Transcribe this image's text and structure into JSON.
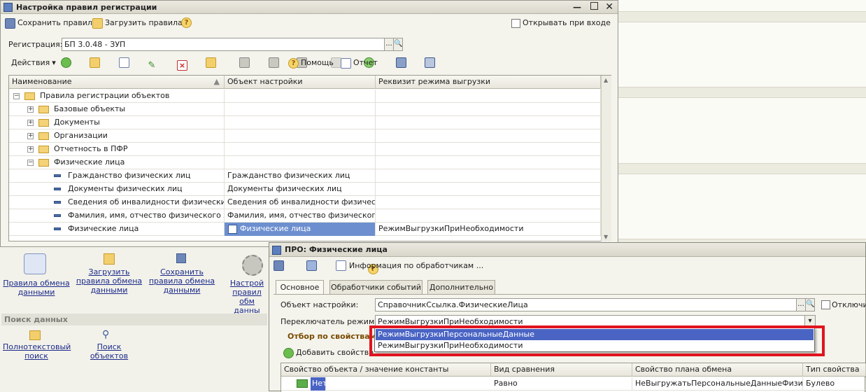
{
  "main_window": {
    "title": "Настройка правил регистрации",
    "toolbar": {
      "save_label": "Сохранить правила",
      "load_label": "Загрузить правила",
      "open_on_start_label": "Открывать при входе"
    },
    "registration_label": "Регистрация:",
    "registration_value": "БП 3.0.48 - ЗУП",
    "actions_label": "Действия",
    "help_label": "Помощь",
    "report_label": "Отчет",
    "columns": [
      "Наименование",
      "Объект настройки",
      "Реквизит режима выгрузки"
    ],
    "rows": [
      {
        "name": "Правила регистрации объектов",
        "object": "",
        "attr": ""
      },
      {
        "name": "Базовые объекты",
        "object": "",
        "attr": ""
      },
      {
        "name": "Документы",
        "object": "",
        "attr": ""
      },
      {
        "name": "Организации",
        "object": "",
        "attr": ""
      },
      {
        "name": "Отчетность в ПФР",
        "object": "",
        "attr": ""
      },
      {
        "name": "Физические лица",
        "object": "",
        "attr": ""
      },
      {
        "name": "Гражданство физических лиц",
        "object": "Гражданство физических лиц",
        "attr": ""
      },
      {
        "name": "Документы физических лиц",
        "object": "Документы физических лиц",
        "attr": ""
      },
      {
        "name": "Сведения об инвалидности физических л...",
        "object": "Сведения об инвалидности физическ...",
        "attr": ""
      },
      {
        "name": "Фамилия, имя, отчество физического ли...",
        "object": "Фамилия, имя, отчество физического ...",
        "attr": ""
      },
      {
        "name": "Физические лица",
        "object": "Физические лица",
        "attr": "РежимВыгрузкиПриНеобходимости"
      }
    ]
  },
  "left_panel": {
    "commands": [
      {
        "label": "Правила обмена данными"
      },
      {
        "label": "Загрузить правила обмена данными"
      },
      {
        "label": "Сохранить правила обмена данными"
      },
      {
        "label": "Настрой правил обм данны"
      }
    ],
    "search_section": "Поиск данных",
    "fulltext_label": "Полнотекстовый поиск",
    "object_search_label": "Поиск объектов"
  },
  "pro_window": {
    "title": "ПРО: Физические лица",
    "handlers_info_label": "Информация по обработчикам ...",
    "tabs": [
      "Основное",
      "Обработчики событий",
      "Дополнительно"
    ],
    "object_label": "Объект настройки:",
    "object_value": "СправочникСсылка.ФизическиеЛица",
    "disable_label": "Отключит",
    "mode_switch_label": "Переключатель режима:",
    "mode_switch_value": "РежимВыгрузкиПриНеобходимости",
    "dropdown_options": [
      "РежимВыгрузкиПерсональныеДанные",
      "РежимВыгрузкиПриНеобходимости"
    ],
    "filter_title": "Отбор по свойствам",
    "add_property_label": "Добавить свойство",
    "columns": [
      "Свойство объекта / значение константы",
      "Вид сравнения",
      "Свойство плана обмена",
      "Тип свойства"
    ],
    "row": {
      "value": "Нет",
      "comparison": "Равно",
      "plan_property": "НеВыгружатьПерсональныеДанныеФизиче...",
      "type": "Булево"
    }
  },
  "colors": {
    "selection": "#4a64c4",
    "highlight_border": "#e0141e",
    "selected_cell": "#6d8fd0"
  }
}
